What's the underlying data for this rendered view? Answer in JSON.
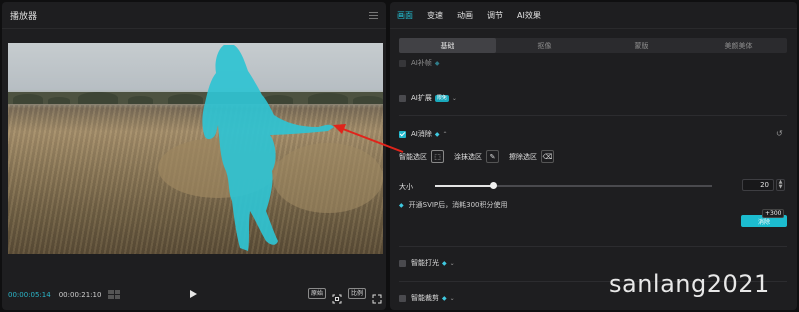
{
  "player": {
    "title": "播放器",
    "time_current": "00:00:05:14",
    "time_total": "00:00:21:10",
    "btn_original": "原始",
    "btn_ratio": "比例"
  },
  "inspector": {
    "tabs": [
      {
        "label": "画面",
        "active": true
      },
      {
        "label": "变速",
        "active": false
      },
      {
        "label": "动画",
        "active": false
      },
      {
        "label": "调节",
        "active": false
      },
      {
        "label": "AI效果",
        "active": false
      }
    ],
    "subtabs": [
      {
        "label": "基础",
        "active": true
      },
      {
        "label": "抠像",
        "active": false
      },
      {
        "label": "蒙版",
        "active": false
      },
      {
        "label": "美颜美体",
        "active": false
      }
    ],
    "features": {
      "ai_cut_label": "AI补帧",
      "ai_expand_label": "AI扩展",
      "ai_expand_badge": "限免",
      "ai_remove_label": "AI消除",
      "tools": [
        {
          "label": "智能选区",
          "icon": "smart-select-icon"
        },
        {
          "label": "涂抹选区",
          "icon": "brush-icon"
        },
        {
          "label": "擦除选区",
          "icon": "eraser-icon"
        }
      ],
      "size_label": "大小",
      "size_value": "20",
      "size_fraction": 0.21,
      "vip_note": "开通SVIP后，消耗300积分使用",
      "apply_label": "消除",
      "cost_badge": "+300",
      "smart_light_label": "智能打光",
      "smart_crop_label": "智能裁剪"
    }
  },
  "watermark": "sanlang2021",
  "colors": {
    "accent": "#23c4d8",
    "arrow": "#e0241b",
    "mask": "#2fc3d2"
  }
}
